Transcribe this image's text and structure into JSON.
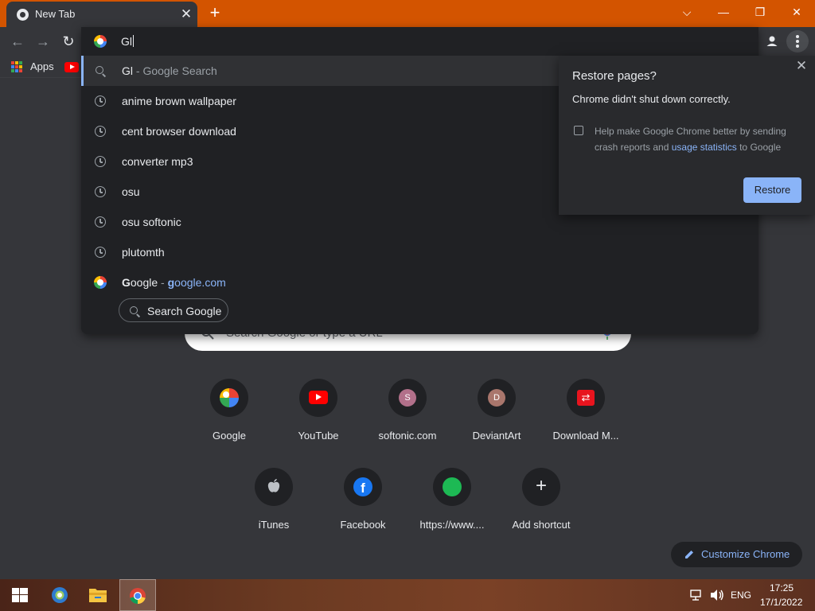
{
  "window": {
    "tab_title": "New Tab",
    "tab_close": "✕",
    "new_tab": "+",
    "controls": {
      "tabsearch": "⌵",
      "minimize": "—",
      "restore": "❐",
      "close": "✕"
    }
  },
  "toolbar": {
    "back": "←",
    "forward": "→",
    "reload": "↻",
    "omnibox_value": "Gl"
  },
  "bookmarks": {
    "apps_label": "Apps",
    "apps_colors": [
      "#ea4335",
      "#fbbc05",
      "#34a853",
      "#4285f4",
      "#ea4335",
      "#fbbc05",
      "#34a853",
      "#4285f4",
      "#ea4335"
    ]
  },
  "suggestions": [
    {
      "text": "Gl",
      "suffix": " - Google Search",
      "icon": "search-icon",
      "selected": true
    },
    {
      "text": "anime brown wallpaper",
      "icon": "history-clock-icon"
    },
    {
      "text": "cent browser download",
      "icon": "history-clock-icon"
    },
    {
      "text": "converter mp3",
      "icon": "history-clock-icon"
    },
    {
      "text": "osu",
      "icon": "history-clock-icon"
    },
    {
      "text": "osu softonic",
      "icon": "history-clock-icon"
    },
    {
      "text": "plutomth",
      "icon": "history-clock-icon"
    }
  ],
  "site_suggestion": {
    "name_bold": "G",
    "name_rest": "oogle",
    "separator": " - ",
    "url_bold": "g",
    "url_rest": "oogle.com",
    "icon": "google-logo-icon"
  },
  "search_google_label": "Search Google",
  "restore_dialog": {
    "title": "Restore pages?",
    "message": "Chrome didn't shut down correctly.",
    "checkbox_text": "Help make Google Chrome better by sending crash reports and ",
    "checkbox_link": "usage statistics",
    "checkbox_text_end": " to Google",
    "button": "Restore",
    "close": "✕"
  },
  "ntp": {
    "search_placeholder": "Search Google or type a URL",
    "shortcuts": [
      {
        "label": "Google",
        "icon": "google-logo-icon"
      },
      {
        "label": "YouTube",
        "icon": "youtube-icon",
        "color": "#ff0000"
      },
      {
        "label": "softonic.com",
        "icon": "letter-s-icon",
        "letter": "S",
        "color": "#b2708a"
      },
      {
        "label": "DeviantArt",
        "icon": "letter-d-icon",
        "letter": "D",
        "color": "#a9766c"
      },
      {
        "label": "Download M...",
        "icon": "download-manager-icon",
        "color": "#e8141e"
      },
      {
        "label": "iTunes",
        "icon": "apple-icon"
      },
      {
        "label": "Facebook",
        "icon": "facebook-icon",
        "color": "#1877f2"
      },
      {
        "label": "https://www....",
        "icon": "green-circle-icon",
        "color": "#1db954"
      },
      {
        "label": "Add shortcut",
        "icon": "plus-icon"
      }
    ],
    "customize_label": "Customize Chrome"
  },
  "taskbar": {
    "lang": "ENG",
    "time": "17:25",
    "date": "17/1/2022"
  },
  "colors": {
    "accent": "#8ab4f8",
    "titlebar": "#d35400",
    "background": "#35363a"
  }
}
